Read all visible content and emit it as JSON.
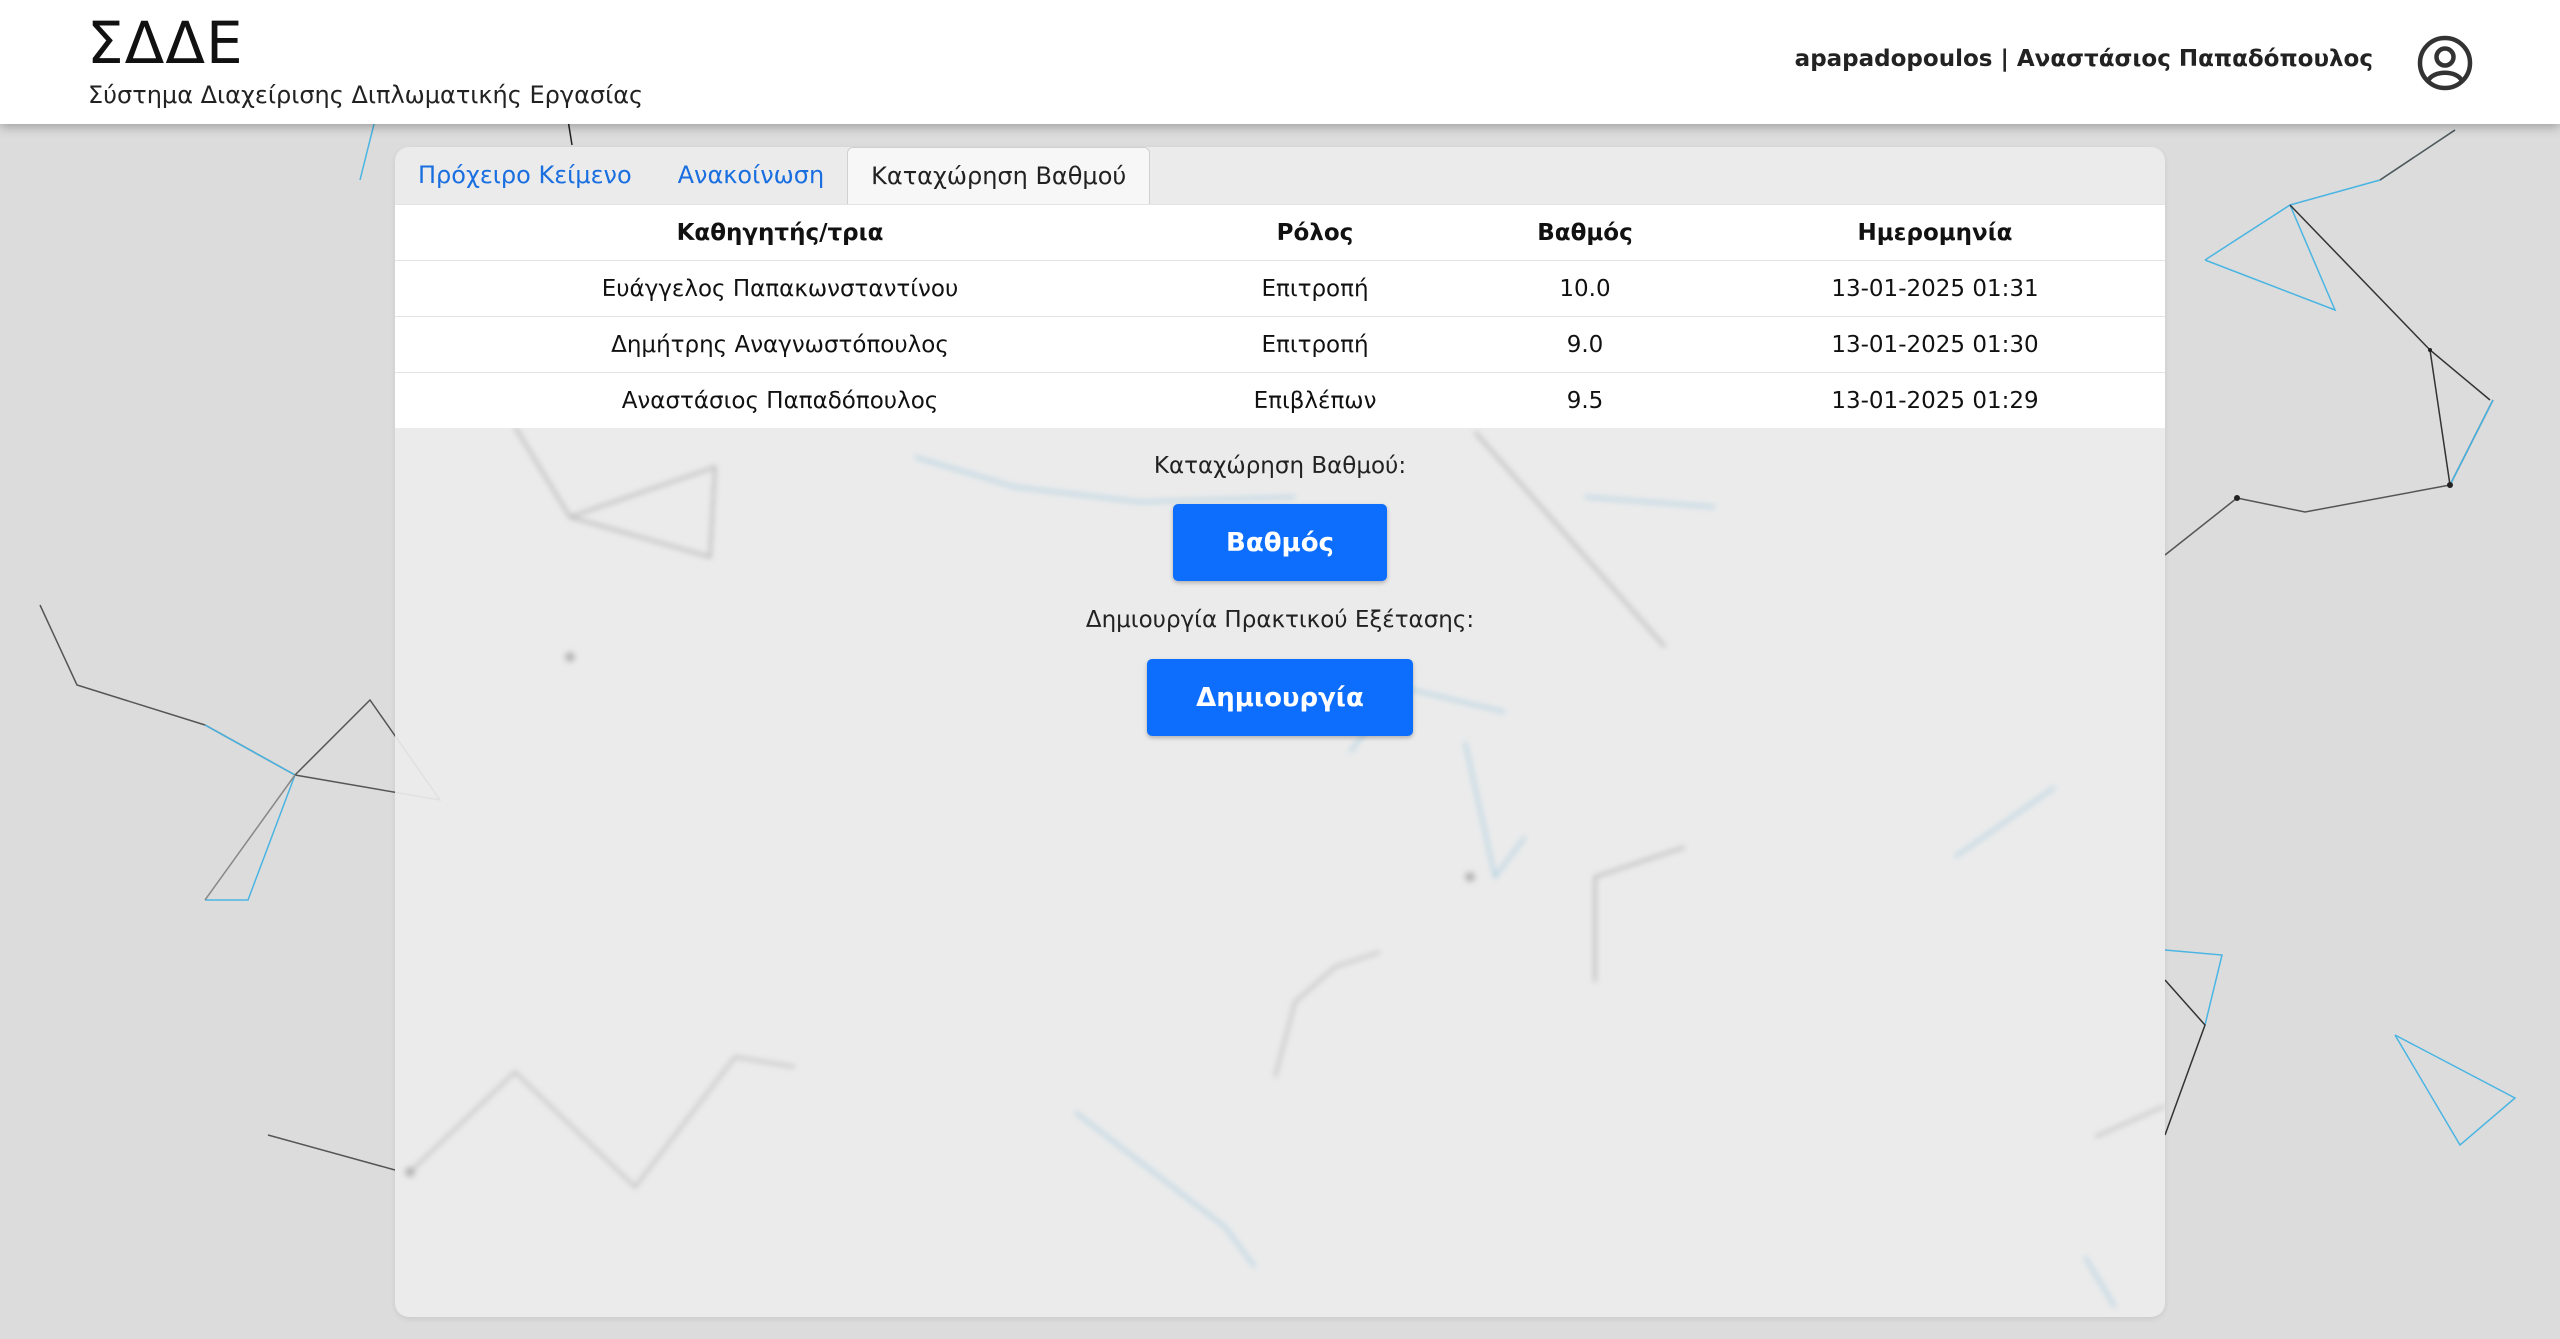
{
  "header": {
    "title": "ΣΔΔΕ",
    "subtitle": "Σύστημα Διαχείρισης Διπλωματικής Εργασίας",
    "user": "apapadopoulos | Αναστάσιος Παπαδόπουλος",
    "user_icon": "user-circle-icon"
  },
  "tabs": [
    {
      "label": "Πρόχειρο Κείμενο",
      "active": false
    },
    {
      "label": "Ανακοίνωση",
      "active": false
    },
    {
      "label": "Καταχώρηση Βαθμού",
      "active": true
    }
  ],
  "table": {
    "headers": [
      "Καθηγητής/τρια",
      "Ρόλος",
      "Βαθμός",
      "Ημερομηνία"
    ],
    "rows": [
      [
        "Ευάγγελος Παπακωνσταντίνου",
        "Επιτροπή",
        "10.0",
        "13-01-2025 01:31"
      ],
      [
        "Δημήτρης Αναγνωστόπουλος",
        "Επιτροπή",
        "9.0",
        "13-01-2025 01:30"
      ],
      [
        "Αναστάσιος Παπαδόπουλος",
        "Επιβλέπων",
        "9.5",
        "13-01-2025 01:29"
      ]
    ]
  },
  "grade_entry": {
    "label": "Καταχώρηση Βαθμού:",
    "button": "Βαθμός"
  },
  "exam_report": {
    "label": "Δημιουργία Πρακτικού Εξέτασης:",
    "button": "Δημιουργία"
  },
  "colors": {
    "primary": "#0d6efd",
    "link": "#1a6fe0",
    "background": "#dcdcdc"
  }
}
